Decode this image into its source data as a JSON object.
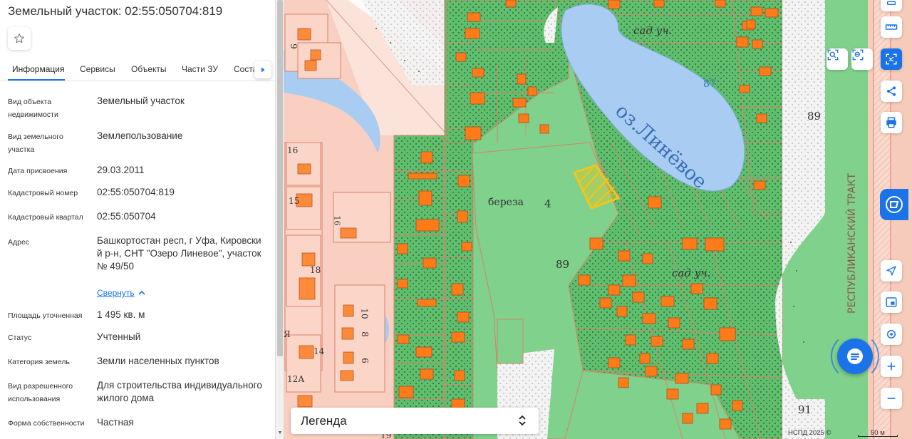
{
  "panel": {
    "title": "Земельный участок: 02:55:050704:819",
    "tabs": [
      "Информация",
      "Сервисы",
      "Объекты",
      "Части ЗУ",
      "Состав ЕЗП"
    ],
    "collapse_label": "Свернуть",
    "rows": [
      {
        "label": "Вид объекта недвижимости",
        "value": "Земельный участок"
      },
      {
        "label": "Вид земельного участка",
        "value": "Землепользование"
      },
      {
        "label": "Дата присвоения",
        "value": "29.03.2011"
      },
      {
        "label": "Кадастровый номер",
        "value": "02:55:050704:819"
      },
      {
        "label": "Кадастровый квартал",
        "value": "02:55:050704"
      },
      {
        "label": "Адрес",
        "value": "Башкортостан респ, г Уфа, Кировский р-н, СНТ \"Озеро Линевое\", участок № 49/50"
      },
      {
        "label": "Площадь уточненная",
        "value": "1 495 кв. м"
      },
      {
        "label": "Статус",
        "value": "Учтенный"
      },
      {
        "label": "Категория земель",
        "value": "Земли населенных пунктов"
      },
      {
        "label": "Вид разрешенного использования",
        "value": "Для строительства индивидуального жилого дома"
      },
      {
        "label": "Форма собственности",
        "value": "Частная"
      }
    ]
  },
  "map": {
    "lake_label": "оз.Линёвое",
    "labels": [
      "сад уч.",
      "сад уч.",
      "береза",
      "89",
      "89",
      "87",
      "91",
      "16",
      "15",
      "18",
      "14",
      "12А",
      "10",
      "8",
      "6",
      "9",
      "Я",
      "16",
      "19",
      "4"
    ],
    "road_label": "РЕСПУБЛИКАНСКИЙ ТРАКТ",
    "legend_label": "Легенда",
    "attribution": "НСПД 2025 ©",
    "scale_label": "50 м",
    "colors": {
      "forest": "#7fd18b",
      "parcel": "#5bbf6c",
      "building": "#ff7b1a",
      "water": "#a9cdf2",
      "urban": "#f7c9b9",
      "selected": "#f5c518",
      "accent": "#1a73e8"
    }
  },
  "icons": {
    "favorite": "star-icon",
    "tab_more": "chevron-right-icon",
    "ruler": "ruler-icon",
    "select_area": "select-area-icon",
    "share": "share-icon",
    "print": "print-icon",
    "geolocate": "navigate-icon",
    "layers": "layers-icon",
    "my_location": "target-icon",
    "zoom_in": "plus-icon",
    "zoom_out": "minus-icon",
    "chat": "chat-icon"
  }
}
